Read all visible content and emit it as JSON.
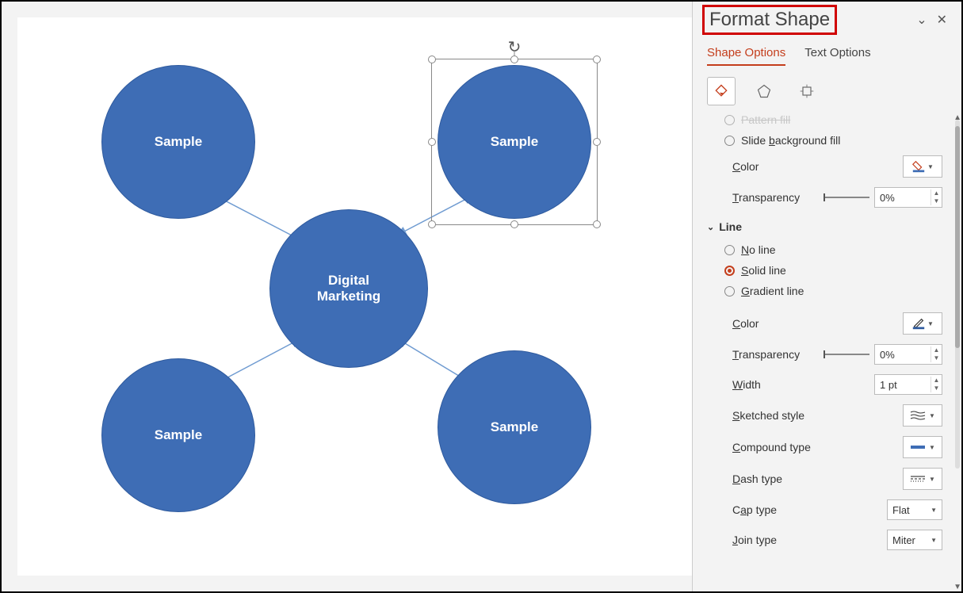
{
  "panel": {
    "title": "Format Shape",
    "tabs": {
      "shape": "Shape Options",
      "text": "Text Options"
    }
  },
  "fill": {
    "pattern_label": "Pattern fill",
    "slidebg_label": "Slide background fill",
    "color_label": "Color",
    "transparency_label": "Transparency",
    "transparency_value": "0%"
  },
  "line": {
    "section": "Line",
    "no_line": "No line",
    "solid_line": "Solid line",
    "gradient_line": "Gradient line",
    "color_label": "Color",
    "transparency_label": "Transparency",
    "transparency_value": "0%",
    "width_label": "Width",
    "width_value": "1 pt",
    "sketched_label": "Sketched style",
    "compound_label": "Compound type",
    "dash_label": "Dash type",
    "cap_label": "Cap type",
    "cap_value": "Flat",
    "join_label": "Join type",
    "join_value": "Miter"
  },
  "shapes": {
    "center": "Digital\nMarketing",
    "tl": "Sample",
    "tr": "Sample",
    "bl": "Sample",
    "br": "Sample"
  }
}
